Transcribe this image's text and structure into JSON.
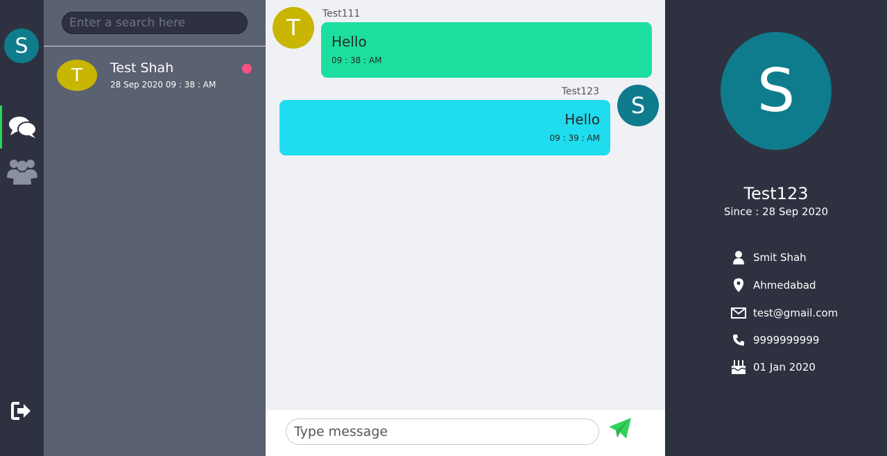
{
  "nav": {
    "me_initial": "S"
  },
  "contacts": {
    "search_placeholder": "Enter a search here",
    "items": [
      {
        "initial": "T",
        "name": "Test Shah",
        "time": "28 Sep 2020 09 : 38 : AM"
      }
    ]
  },
  "chat": {
    "messages": [
      {
        "initial": "T",
        "sender": "Test111",
        "text": "Hello",
        "time": "09 : 38 : AM"
      },
      {
        "initial": "S",
        "sender": "Test123",
        "text": "Hello",
        "time": "09 : 39 : AM"
      }
    ],
    "input_placeholder": "Type message"
  },
  "profile": {
    "initial": "S",
    "username": "Test123",
    "since": "Since : 28 Sep 2020",
    "full_name": "Smit Shah",
    "location": "Ahmedabad",
    "email": "test@gmail.com",
    "phone": "9999999999",
    "birthday": "01 Jan 2020"
  },
  "colors": {
    "accent": "#2ed35a",
    "incoming_bubble": "#1cdf9f",
    "outgoing_bubble": "#1fdcee",
    "unread_dot": "#ff4f82"
  }
}
